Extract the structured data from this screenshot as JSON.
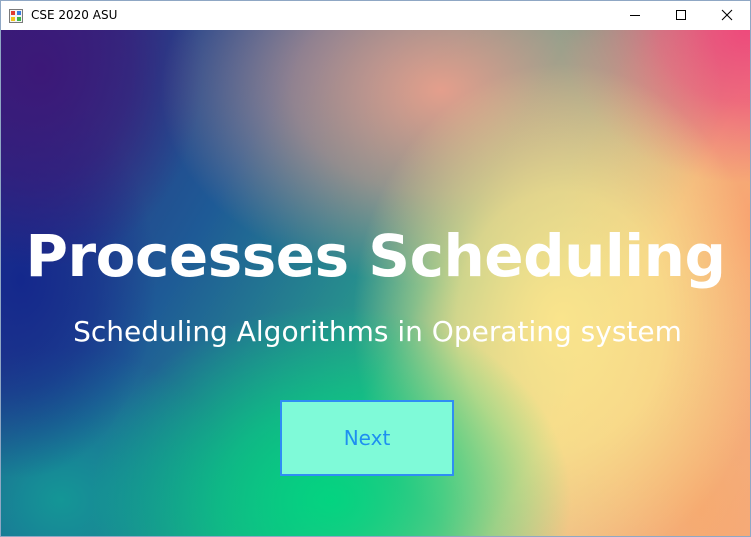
{
  "window": {
    "title": "CSE 2020 ASU",
    "icon": "app-form-icon",
    "controls": [
      "minimize-icon",
      "maximize-icon",
      "close-icon"
    ]
  },
  "main": {
    "title": "Processes Scheduling",
    "subtitle": "Scheduling Algorithms in Operating system",
    "next_button_label": "Next"
  },
  "colors": {
    "title_text": "#ffffff",
    "button_bg": "#7ffad8",
    "button_border": "#2f8df4",
    "button_text": "#1e8ff0"
  }
}
